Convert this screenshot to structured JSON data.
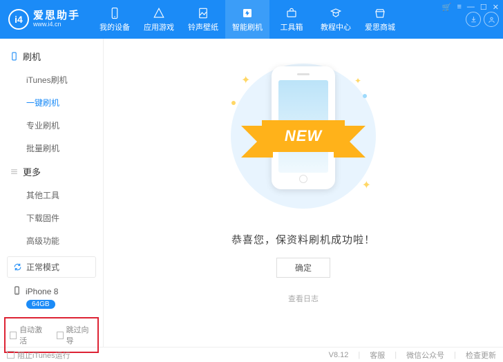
{
  "header": {
    "brand": "爱思助手",
    "site": "www.i4.cn",
    "logo_letters": "i4",
    "nav": [
      {
        "label": "我的设备"
      },
      {
        "label": "应用游戏"
      },
      {
        "label": "铃声壁纸"
      },
      {
        "label": "智能刷机",
        "active": true
      },
      {
        "label": "工具箱"
      },
      {
        "label": "教程中心"
      },
      {
        "label": "爱思商城"
      }
    ]
  },
  "sidebar": {
    "section1_title": "刷机",
    "items1": [
      {
        "label": "iTunes刷机"
      },
      {
        "label": "一键刷机",
        "active": true
      },
      {
        "label": "专业刷机"
      },
      {
        "label": "批量刷机"
      }
    ],
    "section2_title": "更多",
    "items2": [
      {
        "label": "其他工具"
      },
      {
        "label": "下载固件"
      },
      {
        "label": "高级功能"
      }
    ],
    "mode": "正常模式",
    "device_name": "iPhone 8",
    "device_storage": "64GB",
    "cb1": "自动激活",
    "cb2": "跳过向导"
  },
  "main": {
    "ribbon": "NEW",
    "message": "恭喜您，保资料刷机成功啦！",
    "ok": "确定",
    "view_log": "查看日志"
  },
  "footer": {
    "stop_itunes": "阻止iTunes运行",
    "version": "V8.12",
    "support": "客服",
    "wechat": "微信公众号",
    "update": "检查更新"
  }
}
